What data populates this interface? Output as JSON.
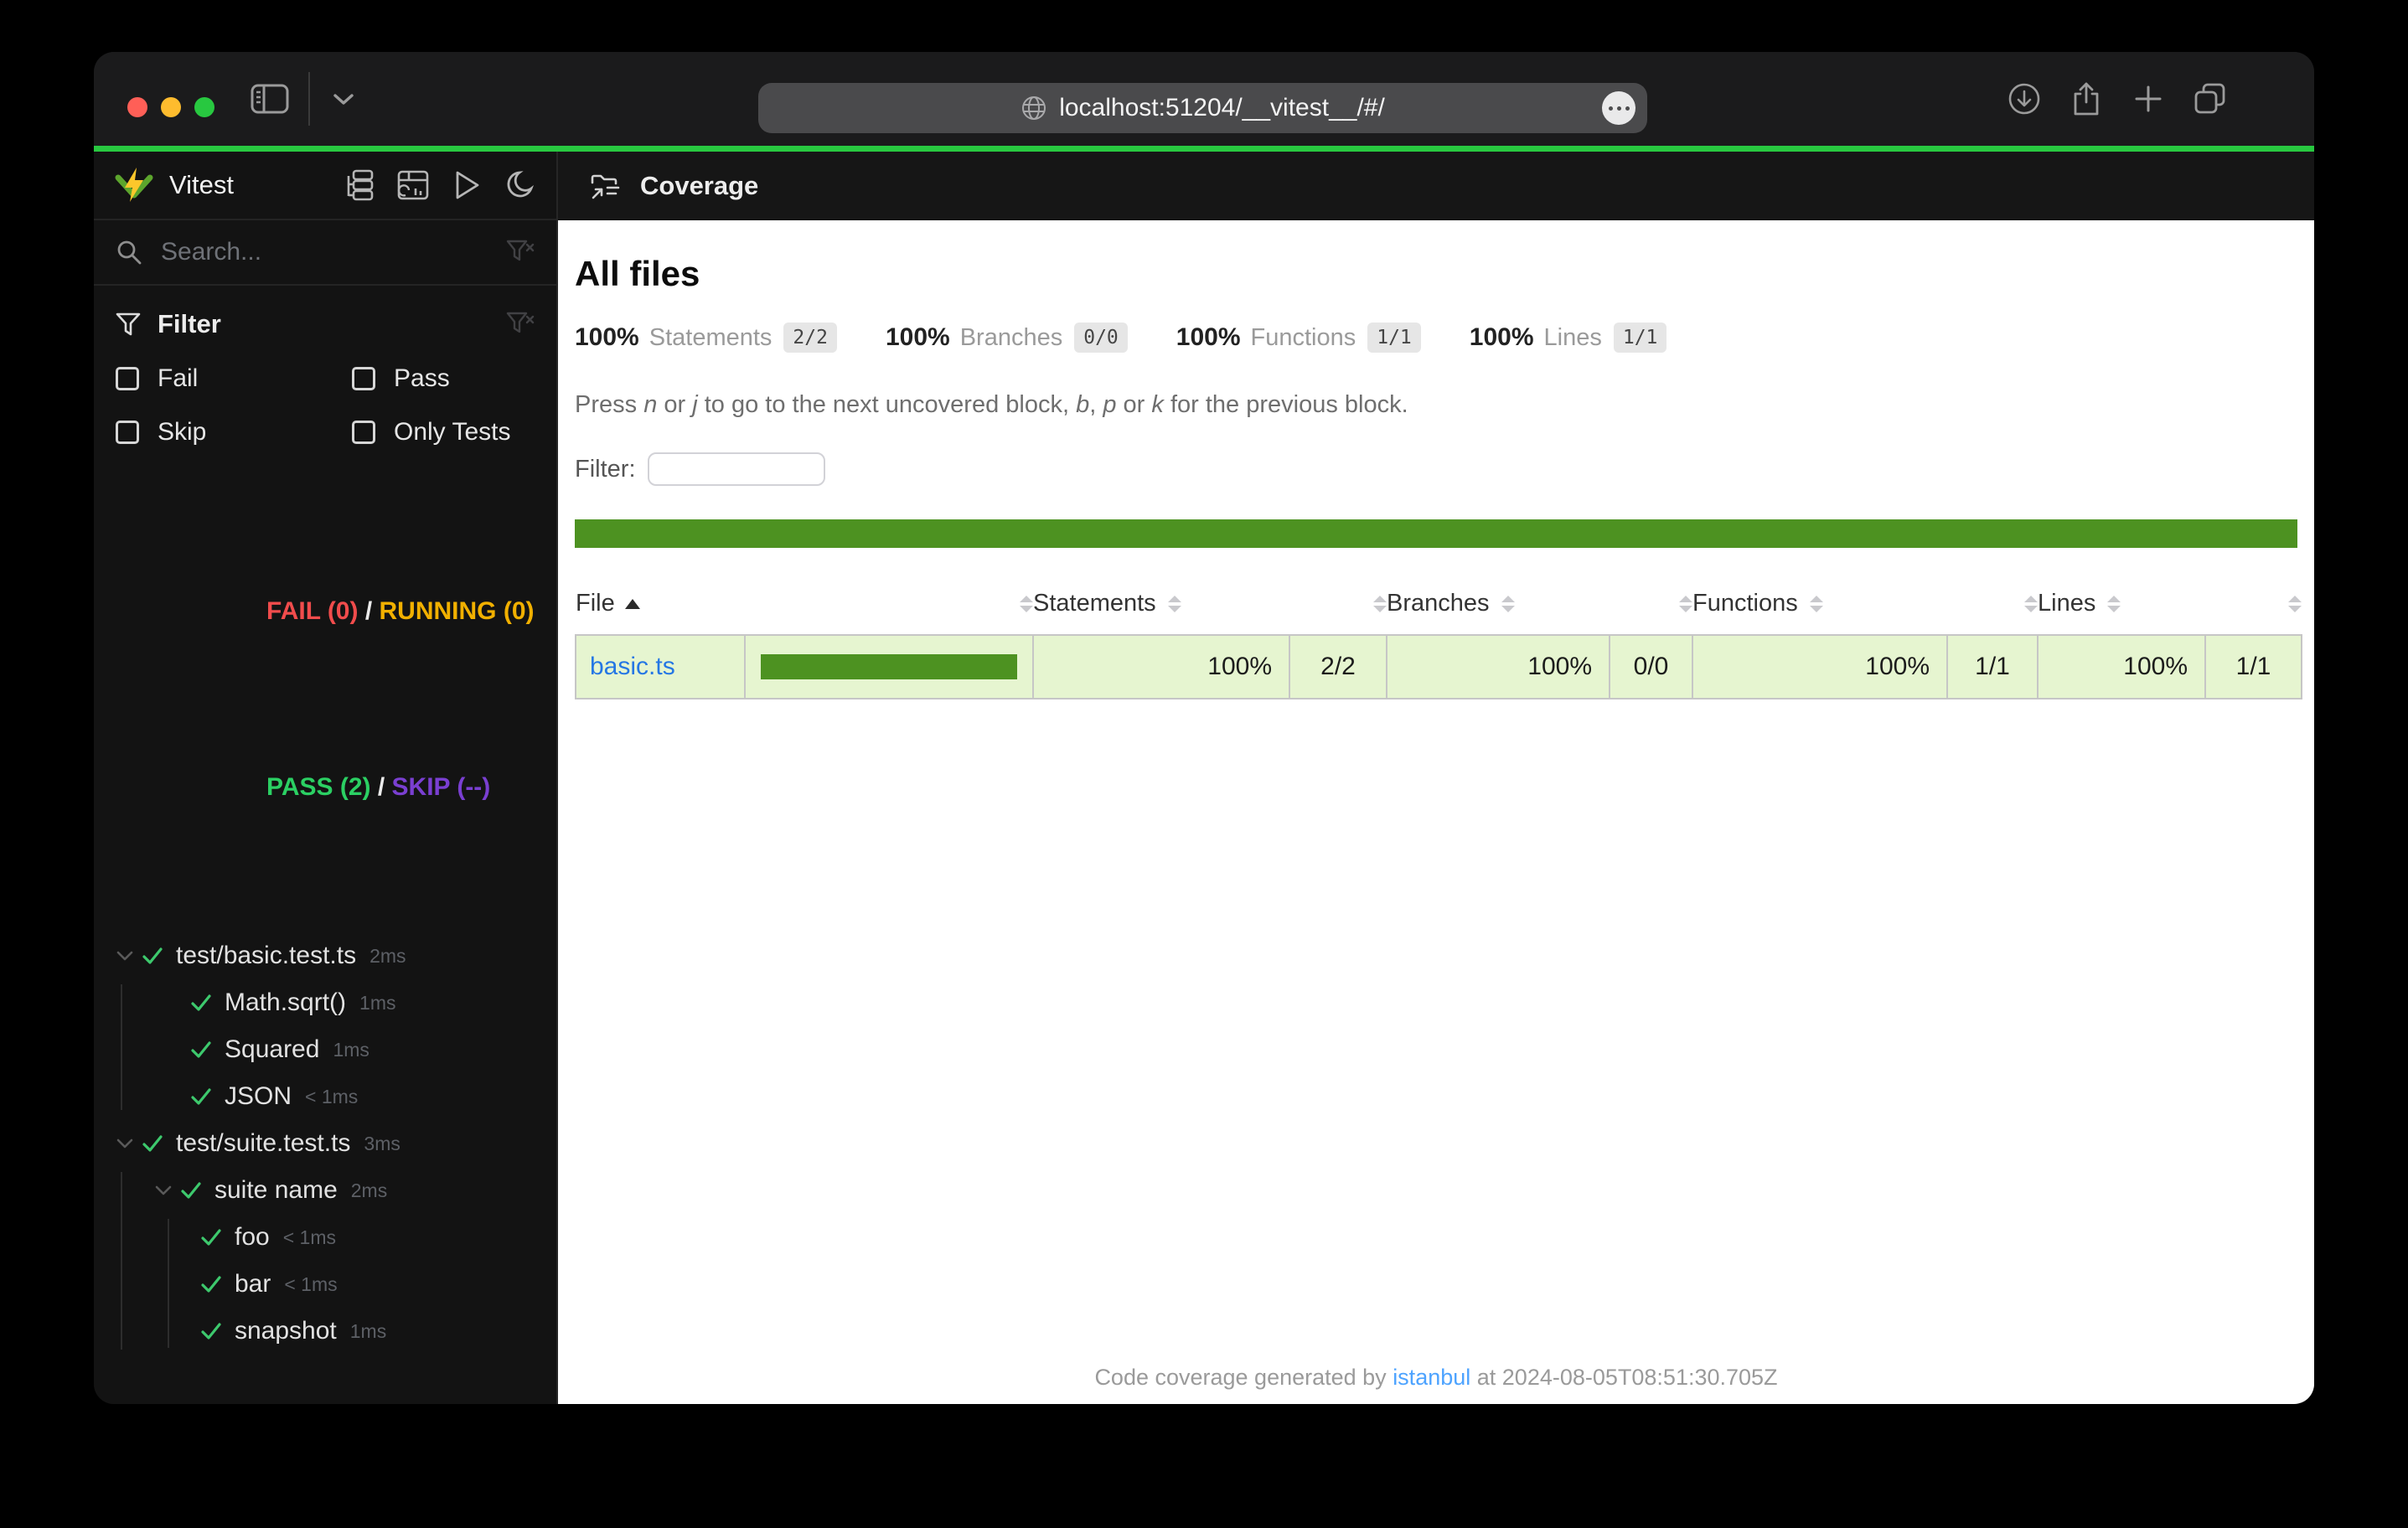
{
  "colors": {
    "traffic-red": "#ff5f57",
    "traffic-yellow": "#febc2e",
    "traffic-green": "#28c840",
    "progress-green": "#28c840",
    "coverage-green": "#4d9221",
    "coverage-row-bg": "#e6f5d0",
    "fail-red": "#f14c4c",
    "running-yellow": "#f1b000",
    "pass-green": "#2bd063",
    "skip-purple": "#7a3fd1",
    "link-blue": "#2577e4",
    "footer-link-blue": "#4da3ff",
    "check-green": "#3dc96d"
  },
  "browser": {
    "url": "localhost:51204/__vitest__/#/"
  },
  "sidebar": {
    "title": "Vitest",
    "search_placeholder": "Search...",
    "filter": {
      "title": "Filter",
      "options": {
        "fail": "Fail",
        "pass": "Pass",
        "skip": "Skip",
        "only_tests": "Only Tests"
      }
    },
    "status": {
      "fail": "FAIL (0)",
      "running": "RUNNING (0)",
      "pass": "PASS (2)",
      "skip": "SKIP (--)",
      "sep": " / "
    },
    "tree": [
      {
        "label": "test/basic.test.ts",
        "duration": "2ms"
      },
      {
        "label": "Math.sqrt()",
        "duration": "1ms"
      },
      {
        "label": "Squared",
        "duration": "1ms"
      },
      {
        "label": "JSON",
        "duration": "< 1ms"
      },
      {
        "label": "test/suite.test.ts",
        "duration": "3ms"
      },
      {
        "label": "suite name",
        "duration": "2ms"
      },
      {
        "label": "foo",
        "duration": "< 1ms"
      },
      {
        "label": "bar",
        "duration": "< 1ms"
      },
      {
        "label": "snapshot",
        "duration": "1ms"
      }
    ]
  },
  "main": {
    "header_title": "Coverage",
    "coverage": {
      "heading": "All files",
      "stats": [
        {
          "pct": "100%",
          "label": "Statements",
          "frac": "2/2"
        },
        {
          "pct": "100%",
          "label": "Branches",
          "frac": "0/0"
        },
        {
          "pct": "100%",
          "label": "Functions",
          "frac": "1/1"
        },
        {
          "pct": "100%",
          "label": "Lines",
          "frac": "1/1"
        }
      ],
      "hint": {
        "p1": "Press ",
        "k1": "n",
        "p2": " or ",
        "k2": "j",
        "p3": " to go to the next uncovered block, ",
        "k3": "b",
        "p4": ", ",
        "k4": "p",
        "p5": " or ",
        "k5": "k",
        "p6": " for the previous block."
      },
      "filter_label": "Filter:",
      "table": {
        "columns": [
          "File",
          "Statements",
          "Branches",
          "Functions",
          "Lines"
        ],
        "rows": [
          {
            "file": "basic.ts",
            "bar_pct": 100,
            "statements_pct": "100%",
            "statements": "2/2",
            "branches_pct": "100%",
            "branches": "0/0",
            "functions_pct": "100%",
            "functions": "1/1",
            "lines_pct": "100%",
            "lines": "1/1"
          }
        ]
      },
      "footer": {
        "prefix": "Code coverage generated by ",
        "tool": "istanbul",
        "suffix": " at 2024-08-05T08:51:30.705Z"
      }
    }
  }
}
